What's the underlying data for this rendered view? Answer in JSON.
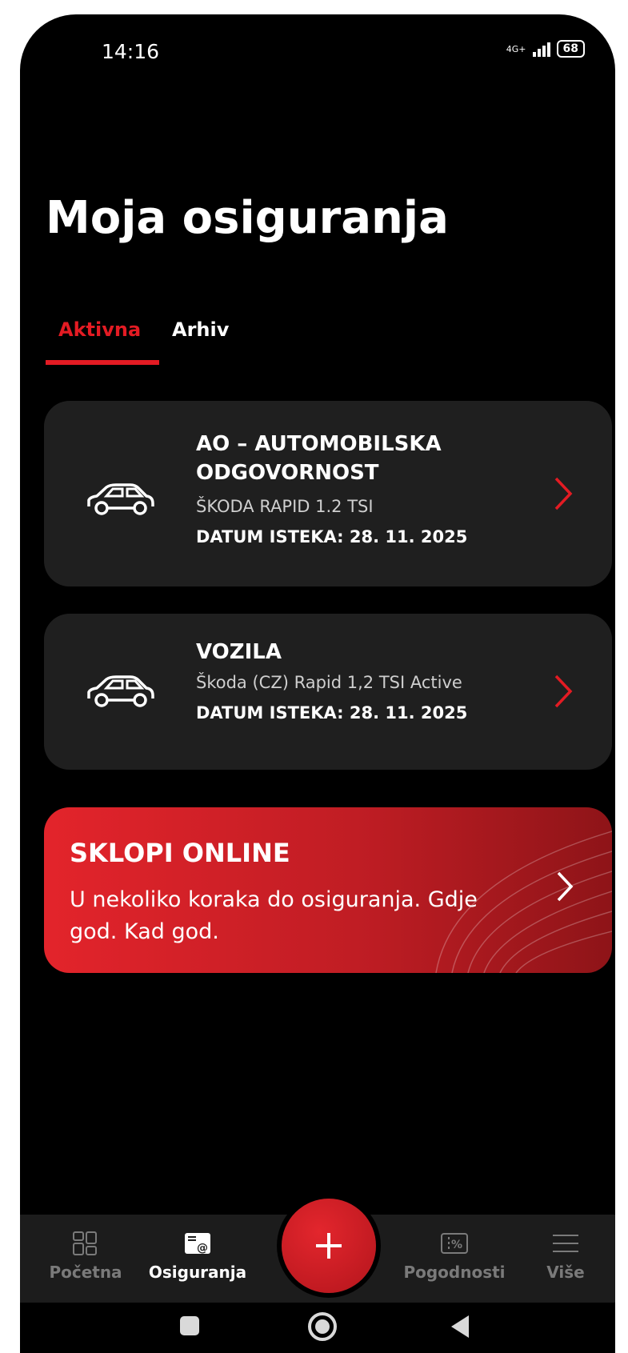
{
  "status_bar": {
    "time": "14:16",
    "network": "4G+",
    "battery": "68"
  },
  "page": {
    "title": "Moja osiguranja"
  },
  "tabs": [
    {
      "label": "Aktivna",
      "active": true
    },
    {
      "label": "Arhiv",
      "active": false
    }
  ],
  "policies": [
    {
      "icon": "car-icon",
      "name": "AO – AUTOMOBILSKA ODGOVORNOST",
      "vehicle": "ŠKODA RAPID 1.2 TSI",
      "expiry": "DATUM ISTEKA: 28. 11. 2025"
    },
    {
      "icon": "car-icon",
      "name": "VOZILA",
      "vehicle": "Škoda (CZ) Rapid 1,2 TSI Active",
      "expiry": "DATUM ISTEKA: 28. 11. 2025"
    }
  ],
  "promo": {
    "title": "SKLOPI ONLINE",
    "subtitle": "U nekoliko koraka do osiguranja. Gdje god. Kad god."
  },
  "bottom_nav": [
    {
      "label": "Početna",
      "icon": "dashboard-icon",
      "active": false
    },
    {
      "label": "Osiguranja",
      "icon": "document-icon",
      "active": true
    },
    {
      "label": "Pogodnosti",
      "icon": "discount-ticket-icon",
      "active": false
    },
    {
      "label": "Više",
      "icon": "menu-icon",
      "active": false
    }
  ],
  "colors": {
    "accent": "#e31b23",
    "background": "#000000",
    "card": "#1f1f1f",
    "nav": "#1c1c1c"
  }
}
